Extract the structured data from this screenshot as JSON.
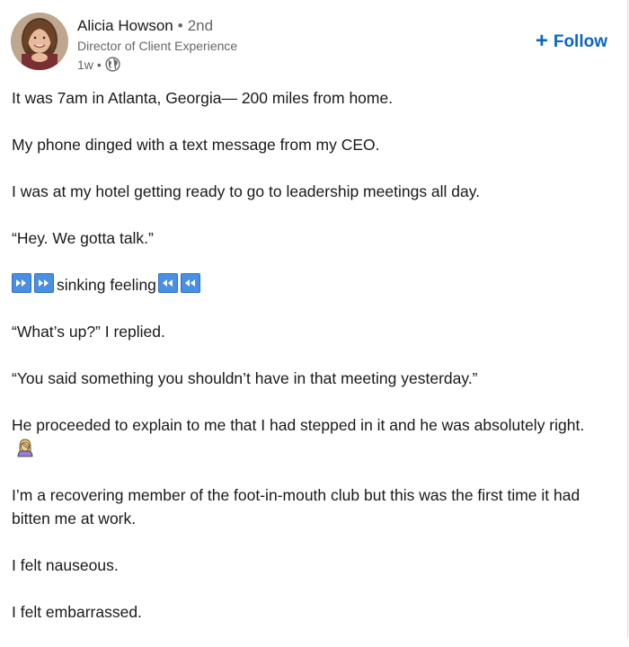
{
  "author": {
    "name": "Alicia Howson",
    "degree": "2nd",
    "separator": "•",
    "headline": "Director of Client Experience",
    "time": "1w",
    "time_separator": "•",
    "visibility_icon": "globe-icon"
  },
  "actions": {
    "follow_label": "Follow",
    "follow_icon": "plus-icon"
  },
  "colors": {
    "accent": "#0a66c2",
    "text": "#191919",
    "muted": "#666666",
    "emoji_blue": "#4a90e2"
  },
  "post": {
    "paragraphs": [
      "It was 7am in Atlanta, Georgia— 200 miles from home.",
      "My phone dinged with a text message from my CEO.",
      "I was at my hotel getting ready to go to leadership meetings all day.",
      "“Hey. We gotta talk.”",
      "sinking feeling",
      "“What’s up?” I replied.",
      "“You said something you shouldn’t have in that meeting yesterday.”",
      "He proceeded to explain to me that I had stepped in it and he was absolutely right.",
      "I’m a recovering member of the foot-in-mouth club but this was the first time it had bitten me at work.",
      "I felt nauseous.",
      "I felt embarrassed."
    ],
    "emoji_fast_forward": "fast-forward-icon",
    "emoji_rewind": "rewind-icon",
    "emoji_facepalm": "facepalm-icon"
  }
}
